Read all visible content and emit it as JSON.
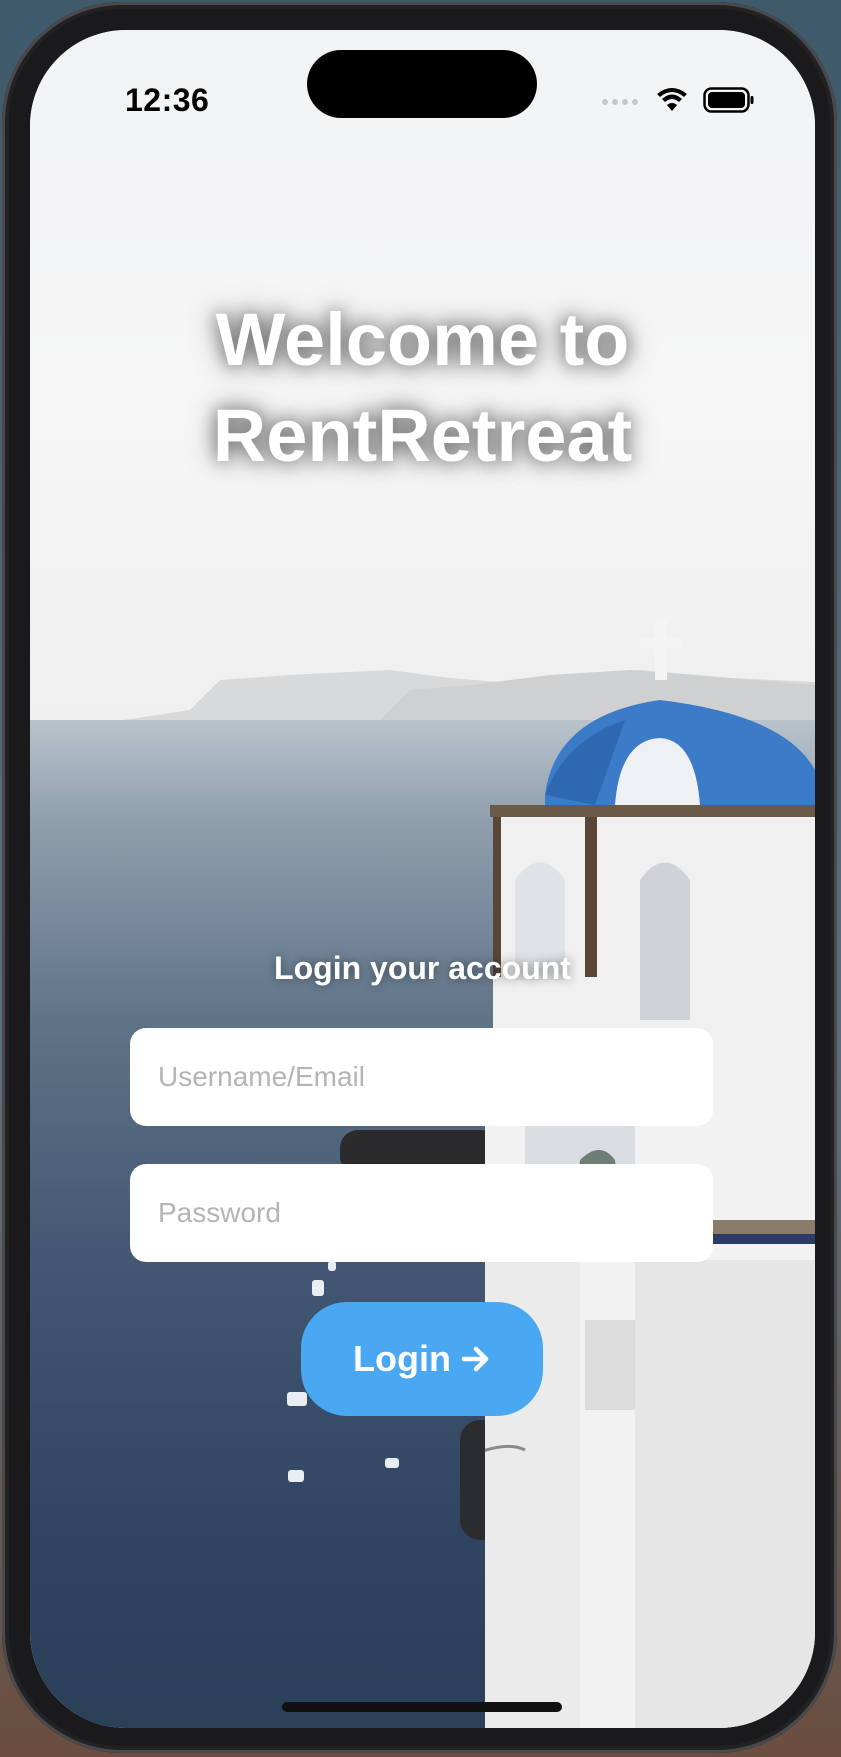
{
  "status_bar": {
    "time": "12:36"
  },
  "screen": {
    "title_line1": "Welcome to",
    "title_line2": "RentRetreat",
    "subtitle": "Login your account"
  },
  "form": {
    "username_placeholder": "Username/Email",
    "password_placeholder": "Password",
    "login_label": "Login"
  },
  "icons": {
    "signal": "cellular-signal-icon",
    "wifi": "wifi-icon",
    "battery": "battery-icon",
    "arrow": "arrow-right-icon"
  },
  "colors": {
    "accent": "#4aa8f2",
    "dome": "#3b7bc8",
    "field_bg": "#ffffff",
    "title_text": "#ffffff"
  }
}
